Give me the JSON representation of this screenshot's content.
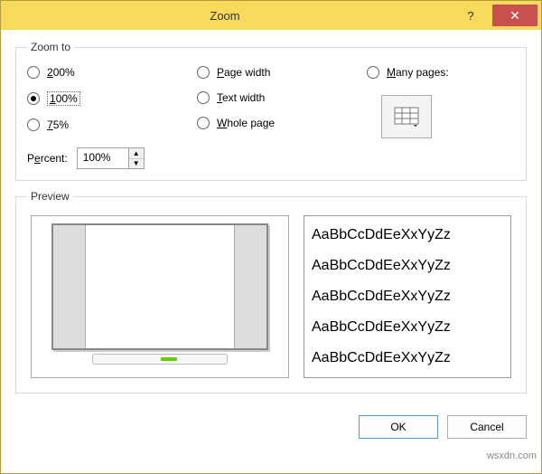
{
  "title": "Zoom",
  "group_labels": {
    "zoom_to": "Zoom to",
    "preview": "Preview"
  },
  "radios": {
    "p200": "200%",
    "p100": "100%",
    "p75": "75%",
    "page_width": "Page width",
    "text_width": "Text width",
    "whole_page": "Whole page",
    "many_pages": "Many pages:"
  },
  "selected": "p100",
  "percent": {
    "label": "Percent:",
    "value": "100%"
  },
  "sample_text": "AaBbCcDdEeXxYyZz",
  "buttons": {
    "ok": "OK",
    "cancel": "Cancel"
  },
  "watermark": "wsxdn.com"
}
